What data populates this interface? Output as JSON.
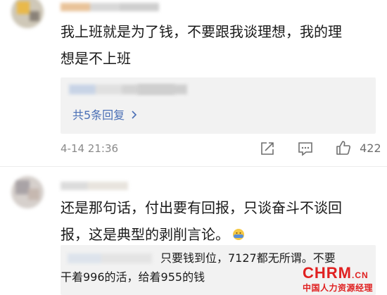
{
  "comments": [
    {
      "text_line1": "我上班就是为了钱，不要跟我谈理想，我的理",
      "text_line2": "想是不上班",
      "reply_count_label": "共5条回复",
      "timestamp": "4-14 21:36",
      "like_count": "422"
    },
    {
      "text_line1": "还是那句话，付出要有回报，只谈奋斗不谈回",
      "text_line2": "报，这是典型的剥削言论。",
      "reply_line1": "只要钱到位，7127都无所谓。不要",
      "reply_line2": "干着996的活，给着955的钱"
    }
  ],
  "icons": [
    "share-icon",
    "comment-icon",
    "like-icon",
    "expand-chevron-icon",
    "cover-face-emoji"
  ],
  "watermark": {
    "brand": "CHRM",
    "domain": ".CN",
    "tagline": "中国人力资源经理"
  },
  "colors": {
    "link": "#4a6fb5",
    "meta": "#8a8a8a",
    "reply_bg": "#f2f2f2",
    "watermark_red": "#e02020"
  }
}
